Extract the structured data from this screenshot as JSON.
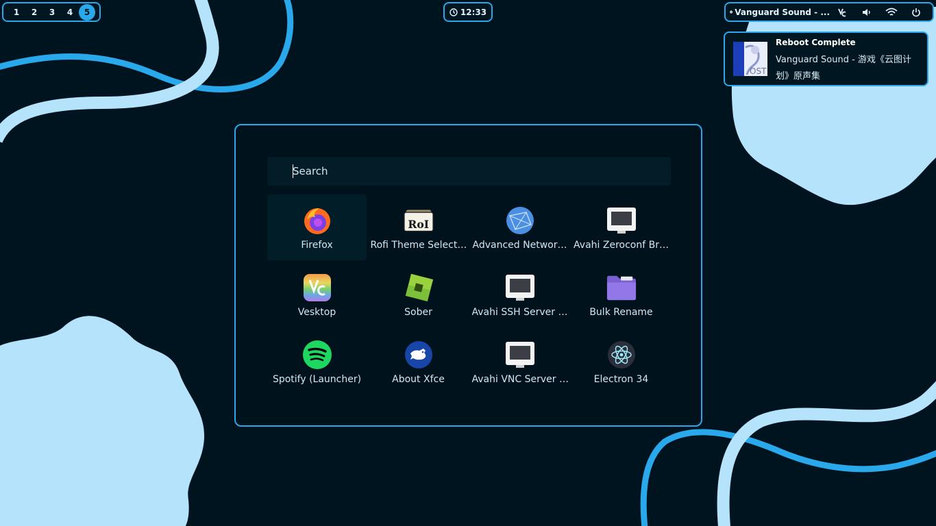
{
  "workspaces": {
    "items": [
      "1",
      "2",
      "3",
      "4",
      "5"
    ],
    "active": "5"
  },
  "clock": {
    "time": "12:33"
  },
  "tray": {
    "media_title": "Vanguard Sound - ...",
    "icons": [
      "vesktop-icon",
      "volume-icon",
      "wifi-icon",
      "power-icon"
    ]
  },
  "notification": {
    "title": "Reboot Complete",
    "body": "Vanguard Sound - 游戏《云图计划》原声集",
    "art_text": "OST"
  },
  "launcher": {
    "search_placeholder": "Search",
    "apps": [
      {
        "label": "Firefox",
        "icon": "firefox-icon"
      },
      {
        "label": "Rofi Theme Select…",
        "icon": "rofi-icon"
      },
      {
        "label": "Advanced Networ…",
        "icon": "network-icon"
      },
      {
        "label": "Avahi Zeroconf Br…",
        "icon": "avahi-zeroconf-icon"
      },
      {
        "label": "Vesktop",
        "icon": "vesktop-icon"
      },
      {
        "label": "Sober",
        "icon": "sober-icon"
      },
      {
        "label": "Avahi SSH Server …",
        "icon": "avahi-ssh-icon"
      },
      {
        "label": "Bulk Rename",
        "icon": "folder-icon"
      },
      {
        "label": "Spotify (Launcher)",
        "icon": "spotify-icon"
      },
      {
        "label": "About Xfce",
        "icon": "xfce-icon"
      },
      {
        "label": "Avahi VNC Server …",
        "icon": "avahi-vnc-icon"
      },
      {
        "label": "Electron 34",
        "icon": "electron-icon"
      }
    ],
    "selected_index": 0
  },
  "colors": {
    "background": "#00141f",
    "accent": "#2aa8ec",
    "shape_light": "#b5e3fb"
  }
}
